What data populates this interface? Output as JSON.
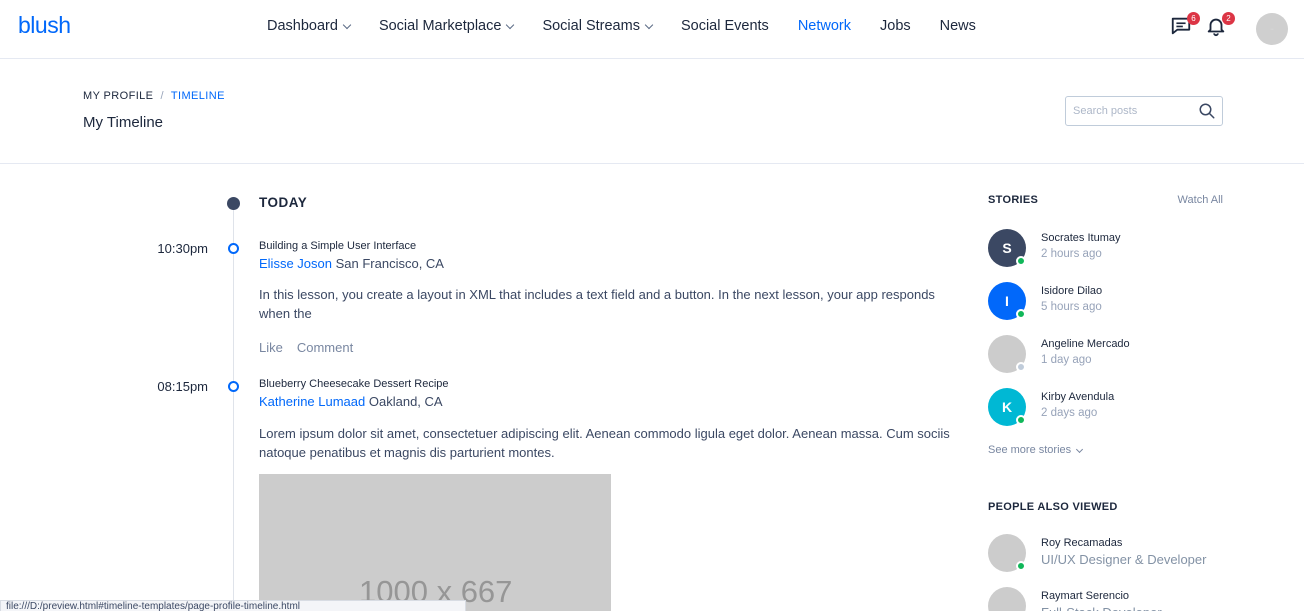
{
  "header": {
    "logo": "blush",
    "nav": [
      {
        "label": "Dashboard",
        "dropdown": true
      },
      {
        "label": "Social Marketplace",
        "dropdown": true
      },
      {
        "label": "Social Streams",
        "dropdown": true
      },
      {
        "label": "Social Events",
        "dropdown": false
      },
      {
        "label": "Network",
        "dropdown": false,
        "active": true
      },
      {
        "label": "Jobs",
        "dropdown": false
      },
      {
        "label": "News",
        "dropdown": false
      }
    ],
    "messages_count": "6",
    "notifications_count": "2",
    "avatar_icon": "user-avatar-placeholder"
  },
  "subheader": {
    "breadcrumb": [
      "My Profile",
      "Timeline"
    ],
    "title": "My Timeline",
    "search_placeholder": "Search posts"
  },
  "timeline": {
    "today_label": "TODAY",
    "posts": [
      {
        "time": "10:30pm",
        "title": "Building a Simple User Interface",
        "author": "Elisse Joson",
        "location": "San Francisco, CA",
        "body": "In this lesson, you create a layout in XML that includes a text field and a button. In the next lesson, your app responds when the",
        "actions": [
          "Like",
          "Comment"
        ]
      },
      {
        "time": "08:15pm",
        "title": "Blueberry Cheesecake Dessert Recipe",
        "author": "Katherine Lumaad",
        "location": "Oakland, CA",
        "body": "Lorem ipsum dolor sit amet, consectetuer adipiscing elit. Aenean commodo ligula eget dolor. Aenean massa. Cum sociis natoque penatibus et magnis dis parturient montes.",
        "image_text": "1000 x 667"
      }
    ]
  },
  "stories": {
    "label": "Stories",
    "watch_all": "Watch All",
    "items": [
      {
        "initial": "S",
        "name": "Socrates Itumay",
        "time": "2 hours ago",
        "color": "#3b4863",
        "status": "#10b759"
      },
      {
        "initial": "I",
        "name": "Isidore Dilao",
        "time": "5 hours ago",
        "color": "#0168fa",
        "status": "#10b759"
      },
      {
        "initial": "",
        "name": "Angeline Mercado",
        "time": "1 day ago",
        "color": "#cccccc",
        "status": "#c0ccda"
      },
      {
        "initial": "K",
        "name": "Kirby Avendula",
        "time": "2 days ago",
        "color": "#00b8d4",
        "status": "#10b759"
      }
    ],
    "see_more": "See more stories"
  },
  "people": {
    "label": "People Also Viewed",
    "items": [
      {
        "name": "Roy Recamadas",
        "role": "UI/UX Designer & Developer",
        "status": "#10b759"
      },
      {
        "name": "Raymart Serencio",
        "role": "Full-Stack Developer",
        "status": "#10b759"
      }
    ]
  },
  "statusbar": {
    "text": "file:///D:/preview.html#timeline-templates/page-profile-timeline.html"
  }
}
